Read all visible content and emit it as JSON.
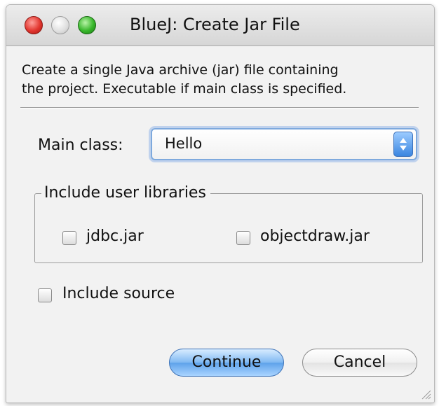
{
  "window": {
    "title": "BlueJ:  Create Jar File"
  },
  "description": {
    "line1": "Create a single Java archive (jar) file containing",
    "line2": "the project. Executable if main class is specified."
  },
  "main_class": {
    "label": "Main class:",
    "selected": "Hello"
  },
  "libraries": {
    "title": "Include user libraries",
    "items": [
      {
        "label": "jdbc.jar",
        "checked": false
      },
      {
        "label": "objectdraw.jar",
        "checked": false
      }
    ]
  },
  "include_source": {
    "label": "Include source",
    "checked": false
  },
  "buttons": {
    "continue_label": "Continue",
    "cancel_label": "Cancel"
  },
  "colors": {
    "accent": "#5ea2ea",
    "close": "#e2362f",
    "zoom": "#38b72b"
  },
  "icons": {
    "close": "close-button-icon",
    "minimize": "minimize-button-icon",
    "zoom": "zoom-button-icon",
    "select_arrows": "updown-arrows-icon",
    "resize": "resize-grip-icon"
  }
}
